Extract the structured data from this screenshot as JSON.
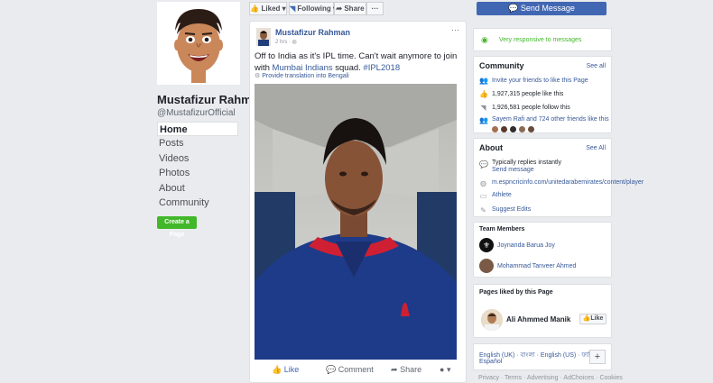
{
  "header": {
    "liked_label": "Liked",
    "following_label": "Following",
    "share_label": "Share",
    "more_label": "···",
    "send_message_label": "Send Message"
  },
  "profile": {
    "name": "Mustafizur Rahman",
    "handle": "@MustafizurOfficial",
    "verified_icon": "✓"
  },
  "nav": {
    "items": [
      {
        "label": "Home"
      },
      {
        "label": "Posts"
      },
      {
        "label": "Videos"
      },
      {
        "label": "Photos"
      },
      {
        "label": "About"
      },
      {
        "label": "Community"
      }
    ],
    "create_page_label": "Create a Page"
  },
  "post": {
    "author": "Mustafizur Rahman",
    "time": "2 hrs",
    "options": "···",
    "text_plain": "Off to India as it's IPL time. Can't wait anymore to join with",
    "text_link": "Mumbai Indians",
    "text_after": " squad. ",
    "hashtag": "#IPL2018",
    "translate_label": "Provide translation into Bengali",
    "actions": {
      "like": "Like",
      "comment": "Comment",
      "share": "Share"
    }
  },
  "right": {
    "responsive": "Very responsive to messages",
    "community": {
      "title": "Community",
      "see_all": "See all",
      "invite": "Invite your friends to like this Page",
      "likes": "1,927,315 people like this",
      "follows": "1,926,581 people follow this",
      "friends": "Sayem Rafi and 724 other friends like this"
    },
    "about": {
      "title": "About",
      "see_all": "See All",
      "reply_line": "Typically replies instantly",
      "send_message": "Send message",
      "website": "m.espncricinfo.com/unitedarabemirates/content/player",
      "category": "Athlete",
      "suggest": "Suggest Edits"
    },
    "team": {
      "title": "Team Members",
      "members": [
        "Joynanda Barua Joy",
        "Mohammad Tanveer Ahmed"
      ]
    },
    "liked": {
      "title": "Pages liked by this Page",
      "page": "Ali Ahmmed Manik",
      "like_btn": "Like"
    },
    "languages": {
      "line1": "English (UK) · বাংলা · English (US) · ফার্সিয়া ·",
      "line2": "Español",
      "plus": "+"
    },
    "footer": "Privacy · Terms · Advertising · AdChoices · Cookies"
  },
  "colors": {
    "brand_blue": "#4267b2",
    "link_blue": "#365899",
    "green": "#42b72a",
    "background": "#e9ebee"
  }
}
